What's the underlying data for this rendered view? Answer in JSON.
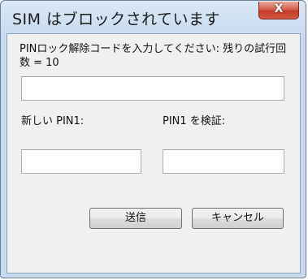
{
  "window": {
    "title": "SIM はブロックされています",
    "close_label": "X"
  },
  "dialog": {
    "prompt": "PINロック解除コードを入力してください: 残りの試行回数 = 10",
    "pin_unlock_code": {
      "value": "",
      "placeholder": ""
    },
    "new_pin_label": "新しい PIN1:",
    "new_pin": {
      "value": "",
      "placeholder": ""
    },
    "verify_pin_label": "PIN1 を検証:",
    "verify_pin": {
      "value": "",
      "placeholder": ""
    },
    "send_label": "送信",
    "cancel_label": "キャンセル"
  },
  "colors": {
    "titlebar": "#c9dcef",
    "close_button": "#c53b24",
    "client_background": "#f0f0f0"
  },
  "icons": {
    "close": "close-icon"
  }
}
